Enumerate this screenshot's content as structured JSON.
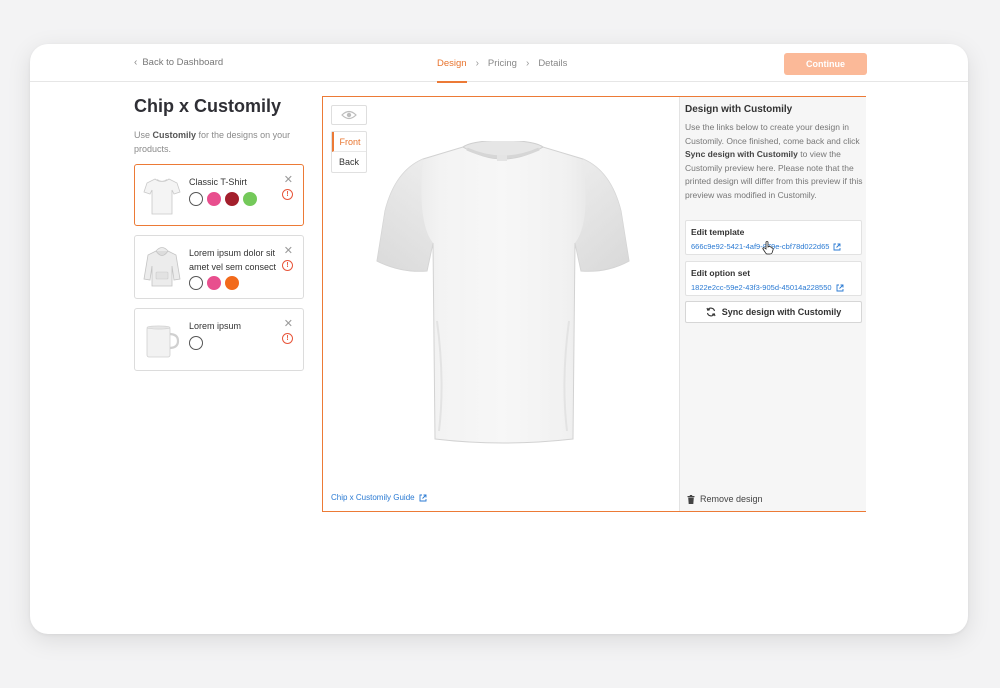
{
  "header": {
    "back_label": "Back to Dashboard",
    "steps": [
      "Design",
      "Pricing",
      "Details"
    ],
    "active_step": "Design",
    "continue_label": "Continue"
  },
  "left": {
    "title": "Chip x Customily",
    "subtitle_prefix": "Use ",
    "subtitle_brand": "Customily",
    "subtitle_suffix": " for the designs on your products.",
    "products": [
      {
        "name": "Classic T-Shirt",
        "thumb": "tshirt-thumbnail",
        "selected": true,
        "swatches": [
          "#ffffff",
          "#e84f8e",
          "#a31f2c",
          "#74c95a"
        ]
      },
      {
        "name": "Lorem ipsum dolor sit amet vel sem consect",
        "thumb": "hoodie-thumbnail",
        "selected": false,
        "swatches": [
          "#ffffff",
          "#e84f8e",
          "#f26a1b"
        ]
      },
      {
        "name": "Lorem ipsum",
        "thumb": "mug-thumbnail",
        "selected": false,
        "swatches": [
          "#ffffff"
        ]
      }
    ]
  },
  "editor": {
    "views": [
      "Front",
      "Back"
    ],
    "active_view": "Front",
    "guide_label": "Chip x Customily Guide"
  },
  "panel": {
    "title": "Design with Customily",
    "desc_1": "Use the links below to create your design in Customily. Once finished, come back and click ",
    "desc_bold": "Sync design with Customily",
    "desc_2": " to view the Customily preview here. Please note that the printed design will differ from this preview if this preview was modified in Customily.",
    "edit_template_label": "Edit template",
    "edit_template_id": "666c9e92-5421-4af9-879e-cbf78d022d65",
    "edit_option_label": "Edit option set",
    "edit_option_id": "1822e2cc-59e2-43f3-905d-45014a228550",
    "sync_label": "Sync design with Customily",
    "remove_label": "Remove design"
  },
  "colors": {
    "accent": "#ec7a36",
    "link": "#2a7ad3",
    "warning": "#e8553a"
  }
}
